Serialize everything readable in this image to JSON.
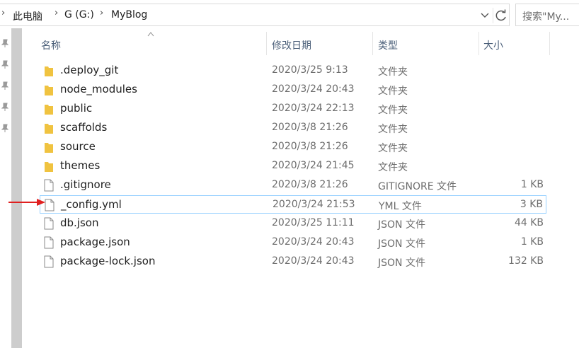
{
  "address": {
    "crumbs": [
      "此电脑",
      "G (G:)",
      "MyBlog"
    ]
  },
  "search": {
    "placeholder": "搜索\"My..."
  },
  "columns": {
    "name": "名称",
    "date": "修改日期",
    "type": "类型",
    "size": "大小"
  },
  "files": [
    {
      "name": ".deploy_git",
      "date": "2020/3/25 9:13",
      "type": "文件夹",
      "size": "",
      "icon": "folder-icon"
    },
    {
      "name": "node_modules",
      "date": "2020/3/24 20:43",
      "type": "文件夹",
      "size": "",
      "icon": "folder-icon"
    },
    {
      "name": "public",
      "date": "2020/3/24 22:13",
      "type": "文件夹",
      "size": "",
      "icon": "folder-icon"
    },
    {
      "name": "scaffolds",
      "date": "2020/3/8 21:26",
      "type": "文件夹",
      "size": "",
      "icon": "folder-icon"
    },
    {
      "name": "source",
      "date": "2020/3/8 21:26",
      "type": "文件夹",
      "size": "",
      "icon": "folder-icon"
    },
    {
      "name": "themes",
      "date": "2020/3/24 21:45",
      "type": "文件夹",
      "size": "",
      "icon": "folder-icon"
    },
    {
      "name": ".gitignore",
      "date": "2020/3/8 21:26",
      "type": "GITIGNORE 文件",
      "size": "1 KB",
      "icon": "file-icon"
    },
    {
      "name": "_config.yml",
      "date": "2020/3/24 21:53",
      "type": "YML 文件",
      "size": "3 KB",
      "icon": "file-icon",
      "selected": true
    },
    {
      "name": "db.json",
      "date": "2020/3/25 11:11",
      "type": "JSON 文件",
      "size": "44 KB",
      "icon": "file-icon"
    },
    {
      "name": "package.json",
      "date": "2020/3/24 20:43",
      "type": "JSON 文件",
      "size": "1 KB",
      "icon": "file-icon"
    },
    {
      "name": "package-lock.json",
      "date": "2020/3/24 20:43",
      "type": "JSON 文件",
      "size": "132 KB",
      "icon": "file-icon"
    }
  ],
  "colors": {
    "folder": "#f0c341",
    "selection_border": "#99d1ff",
    "annotation_arrow": "#e02020",
    "header_text": "#4c607a"
  }
}
